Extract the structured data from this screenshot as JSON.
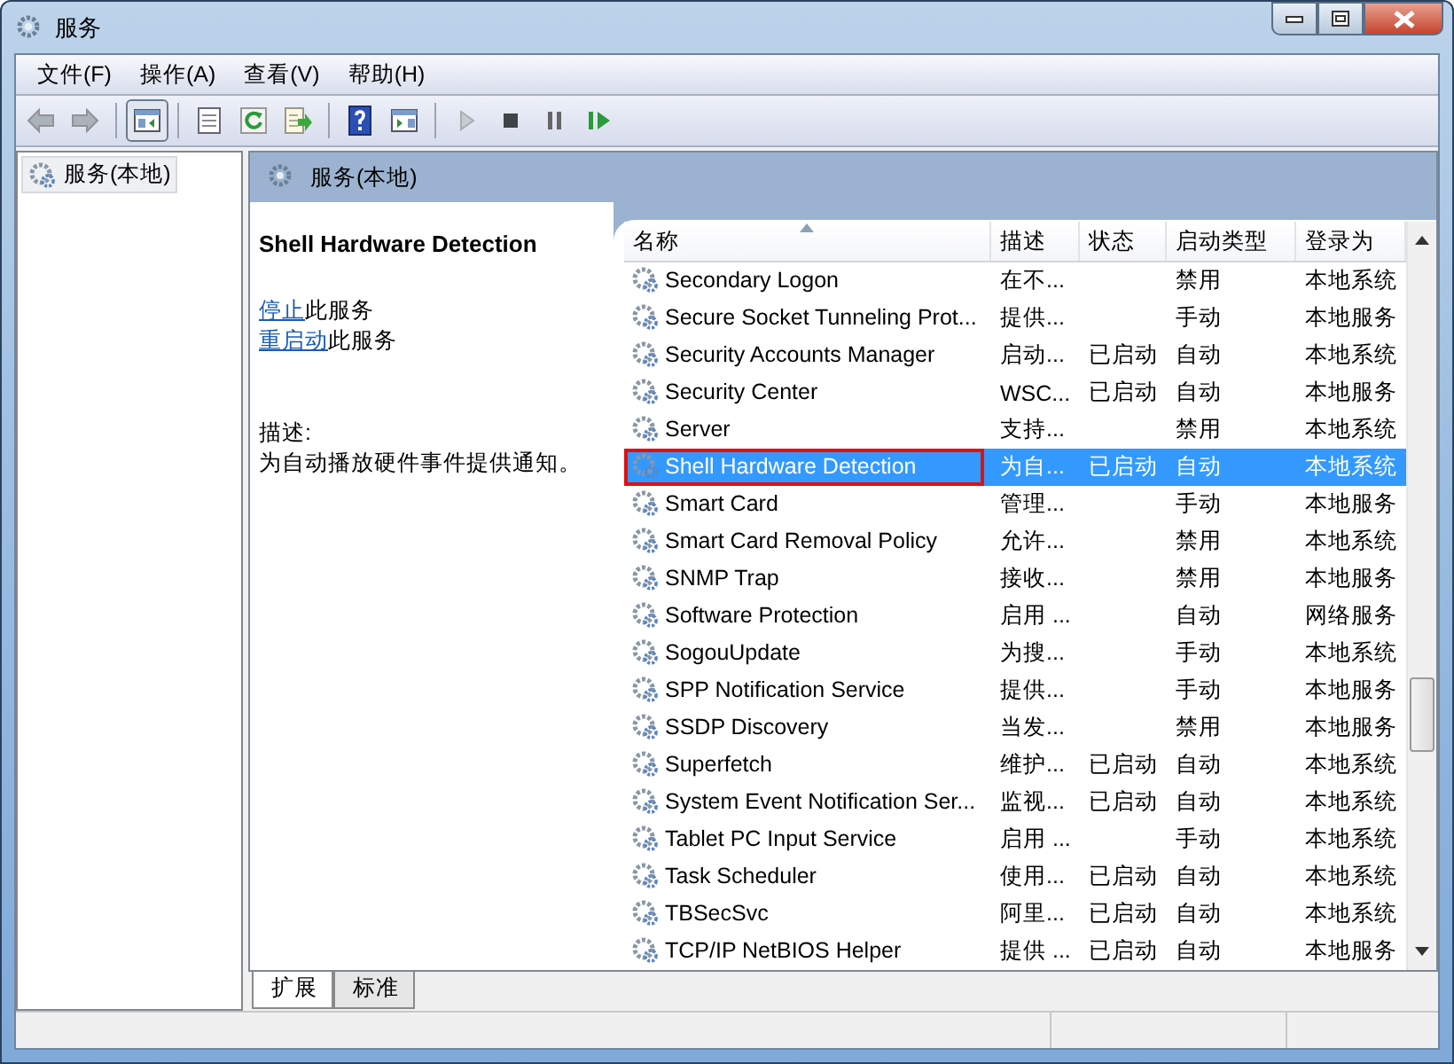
{
  "window": {
    "title": "服务"
  },
  "menu": [
    "文件(F)",
    "操作(A)",
    "查看(V)",
    "帮助(H)"
  ],
  "toolbar": [
    {
      "kind": "back",
      "disabled": true,
      "pressed": false
    },
    {
      "kind": "forward",
      "disabled": true,
      "pressed": false
    },
    {
      "kind": "separator"
    },
    {
      "kind": "tree",
      "disabled": false,
      "pressed": true
    },
    {
      "kind": "separator"
    },
    {
      "kind": "properties",
      "disabled": false,
      "pressed": false
    },
    {
      "kind": "refresh",
      "disabled": false,
      "pressed": false
    },
    {
      "kind": "export",
      "disabled": false,
      "pressed": false
    },
    {
      "kind": "separator"
    },
    {
      "kind": "help",
      "disabled": false,
      "pressed": false
    },
    {
      "kind": "panel",
      "disabled": false,
      "pressed": false
    },
    {
      "kind": "separator"
    },
    {
      "kind": "play",
      "disabled": true,
      "pressed": false
    },
    {
      "kind": "stop",
      "disabled": false,
      "pressed": false
    },
    {
      "kind": "pause",
      "disabled": false,
      "pressed": false
    },
    {
      "kind": "resume",
      "disabled": false,
      "pressed": false
    }
  ],
  "tree": {
    "items": [
      {
        "label": "服务(本地)",
        "selected": true
      }
    ]
  },
  "panel_header": "服务(本地)",
  "details": {
    "title": "Shell Hardware Detection",
    "actions": [
      {
        "link": "停止",
        "text": "此服务"
      },
      {
        "link": "重启动",
        "text": "此服务"
      }
    ],
    "description_label": "描述:",
    "description": "为自动播放硬件事件提供通知。"
  },
  "table": {
    "columns": [
      {
        "label": "名称",
        "sorted": true
      },
      {
        "label": "描述",
        "sorted": false
      },
      {
        "label": "状态",
        "sorted": false
      },
      {
        "label": "启动类型",
        "sorted": false
      },
      {
        "label": "登录为",
        "sorted": false
      }
    ],
    "rows": [
      {
        "name": "Secondary Logon",
        "description": "在不...",
        "status": "",
        "startup": "禁用",
        "logon": "本地系统",
        "selected": false,
        "highlighted": false
      },
      {
        "name": "Secure Socket Tunneling Prot...",
        "description": "提供...",
        "status": "",
        "startup": "手动",
        "logon": "本地服务",
        "selected": false,
        "highlighted": false
      },
      {
        "name": "Security Accounts Manager",
        "description": "启动...",
        "status": "已启动",
        "startup": "自动",
        "logon": "本地系统",
        "selected": false,
        "highlighted": false
      },
      {
        "name": "Security Center",
        "description": "WSC...",
        "status": "已启动",
        "startup": "自动",
        "logon": "本地服务",
        "selected": false,
        "highlighted": false
      },
      {
        "name": "Server",
        "description": "支持...",
        "status": "",
        "startup": "禁用",
        "logon": "本地系统",
        "selected": false,
        "highlighted": false
      },
      {
        "name": "Shell Hardware Detection",
        "description": "为自...",
        "status": "已启动",
        "startup": "自动",
        "logon": "本地系统",
        "selected": true,
        "highlighted": true
      },
      {
        "name": "Smart Card",
        "description": "管理...",
        "status": "",
        "startup": "手动",
        "logon": "本地服务",
        "selected": false,
        "highlighted": false
      },
      {
        "name": "Smart Card Removal Policy",
        "description": "允许...",
        "status": "",
        "startup": "禁用",
        "logon": "本地系统",
        "selected": false,
        "highlighted": false
      },
      {
        "name": "SNMP Trap",
        "description": "接收...",
        "status": "",
        "startup": "禁用",
        "logon": "本地服务",
        "selected": false,
        "highlighted": false
      },
      {
        "name": "Software Protection",
        "description": "启用 ...",
        "status": "",
        "startup": "自动",
        "logon": "网络服务",
        "selected": false,
        "highlighted": false
      },
      {
        "name": "SogouUpdate",
        "description": "为搜...",
        "status": "",
        "startup": "手动",
        "logon": "本地系统",
        "selected": false,
        "highlighted": false
      },
      {
        "name": "SPP Notification Service",
        "description": "提供...",
        "status": "",
        "startup": "手动",
        "logon": "本地服务",
        "selected": false,
        "highlighted": false
      },
      {
        "name": "SSDP Discovery",
        "description": "当发...",
        "status": "",
        "startup": "禁用",
        "logon": "本地服务",
        "selected": false,
        "highlighted": false
      },
      {
        "name": "Superfetch",
        "description": "维护...",
        "status": "已启动",
        "startup": "自动",
        "logon": "本地系统",
        "selected": false,
        "highlighted": false
      },
      {
        "name": "System Event Notification Ser...",
        "description": "监视...",
        "status": "已启动",
        "startup": "自动",
        "logon": "本地系统",
        "selected": false,
        "highlighted": false
      },
      {
        "name": "Tablet PC Input Service",
        "description": "启用 ...",
        "status": "",
        "startup": "手动",
        "logon": "本地系统",
        "selected": false,
        "highlighted": false
      },
      {
        "name": "Task Scheduler",
        "description": "使用...",
        "status": "已启动",
        "startup": "自动",
        "logon": "本地系统",
        "selected": false,
        "highlighted": false
      },
      {
        "name": "TBSecSvc",
        "description": "阿里...",
        "status": "已启动",
        "startup": "自动",
        "logon": "本地系统",
        "selected": false,
        "highlighted": false
      },
      {
        "name": "TCP/IP NetBIOS Helper",
        "description": "提供 ...",
        "status": "已启动",
        "startup": "自动",
        "logon": "本地服务",
        "selected": false,
        "highlighted": false
      }
    ]
  },
  "tabs": [
    {
      "label": "扩展",
      "selected": true
    },
    {
      "label": "标准",
      "selected": false
    }
  ]
}
